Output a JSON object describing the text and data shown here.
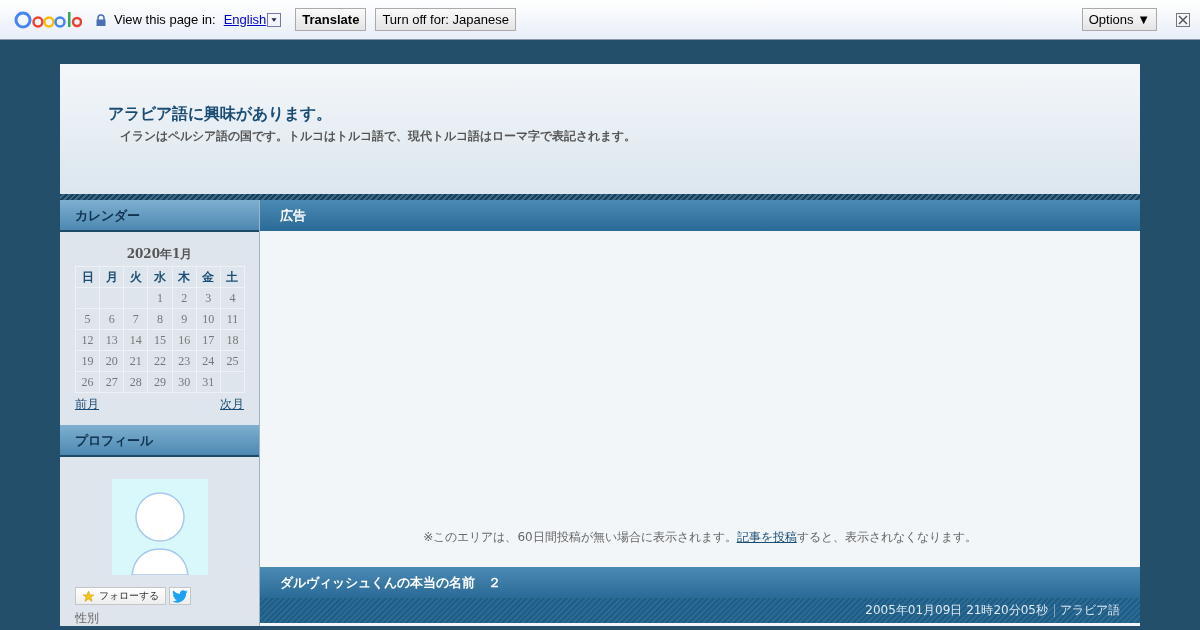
{
  "translate_bar": {
    "prompt": "View this page in:",
    "language": "English",
    "translate_button": "Translate",
    "turn_off_button": "Turn off for: Japanese",
    "options_button": "Options ▼"
  },
  "blog": {
    "title": "アラビア語に興味があります。",
    "description": "イランはペルシア語の国です。トルコはトルコ語で、現代トルコ語はローマ字で表記されます。"
  },
  "sidebar": {
    "calendar": {
      "title": "カレンダー",
      "month": "2020年1月",
      "weekdays": [
        "日",
        "月",
        "火",
        "水",
        "木",
        "金",
        "土"
      ],
      "weeks": [
        [
          {
            "kind": "blank"
          },
          {
            "kind": "blank"
          },
          {
            "kind": "blank"
          },
          {
            "kind": "day",
            "day": "1"
          },
          {
            "kind": "day",
            "day": "2"
          },
          {
            "kind": "day",
            "day": "3"
          },
          {
            "kind": "day",
            "day": "4"
          }
        ],
        [
          {
            "kind": "day",
            "day": "5"
          },
          {
            "kind": "day",
            "day": "6"
          },
          {
            "kind": "day",
            "day": "7"
          },
          {
            "kind": "day",
            "day": "8"
          },
          {
            "kind": "day",
            "day": "9"
          },
          {
            "kind": "day",
            "day": "10"
          },
          {
            "kind": "day",
            "day": "11"
          }
        ],
        [
          {
            "kind": "day",
            "day": "12"
          },
          {
            "kind": "day",
            "day": "13"
          },
          {
            "kind": "day",
            "day": "14"
          },
          {
            "kind": "day",
            "day": "15"
          },
          {
            "kind": "day",
            "day": "16"
          },
          {
            "kind": "day",
            "day": "17"
          },
          {
            "kind": "day",
            "day": "18"
          }
        ],
        [
          {
            "kind": "day",
            "day": "19"
          },
          {
            "kind": "day",
            "day": "20"
          },
          {
            "kind": "day",
            "day": "21"
          },
          {
            "kind": "day",
            "day": "22"
          },
          {
            "kind": "day",
            "day": "23"
          },
          {
            "kind": "day",
            "day": "24"
          },
          {
            "kind": "day",
            "day": "25"
          }
        ],
        [
          {
            "kind": "day",
            "day": "26"
          },
          {
            "kind": "day",
            "day": "27"
          },
          {
            "kind": "day",
            "day": "28"
          },
          {
            "kind": "day",
            "day": "29"
          },
          {
            "kind": "day",
            "day": "30"
          },
          {
            "kind": "day",
            "day": "31"
          },
          {
            "kind": "blank"
          }
        ]
      ],
      "prev": "前月",
      "next": "次月"
    },
    "profile": {
      "title": "プロフィール",
      "follow_button": "フォローする",
      "field_label": "性別"
    }
  },
  "main": {
    "ad": {
      "title": "広告",
      "notice_before": "※このエリアは、60日間投稿が無い場合に表示されます。",
      "notice_link": "記事を投稿",
      "notice_after": "すると、表示されなくなります。"
    },
    "article": {
      "title": "ダルヴィッシュくんの本当の名前　２",
      "date": "2005年01月09日 21時20分05秒",
      "category": "アラビア語"
    }
  }
}
